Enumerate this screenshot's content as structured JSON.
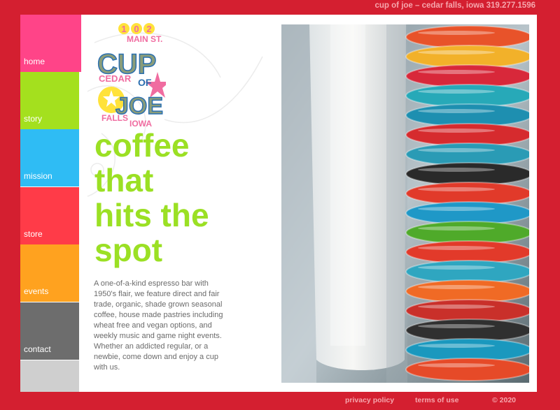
{
  "header": {
    "contact_line": "cup of joe – cedar falls, iowa 319.277.1596"
  },
  "nav": {
    "items": [
      {
        "label": "home",
        "color": "#ff4488"
      },
      {
        "label": "story",
        "color": "#a4e01e"
      },
      {
        "label": "mission",
        "color": "#2fbcf4"
      },
      {
        "label": "store",
        "color": "#ff3b48"
      },
      {
        "label": "events",
        "color": "#ffa21f"
      },
      {
        "label": "contact",
        "color": "#6d6d6d"
      }
    ],
    "blank_color": "#cfcfcf"
  },
  "logo": {
    "number": "102",
    "street": "MAIN ST.",
    "cup": "CUP",
    "of": "OF",
    "joe": "JOE",
    "cedar": "CEDAR",
    "falls": "FALLS",
    "iowa": "IOWA"
  },
  "main": {
    "headline": [
      "coffee",
      "that",
      "hits the",
      "spot"
    ],
    "description": "A one-of-a-kind espresso bar with 1950's flair, we feature direct and fair trade, organic, shade grown seasonal coffee, house made pastries including wheat free and vegan options, and weekly music and game night events. Whether an addicted regular, or a newbie, come down and enjoy a cup with us."
  },
  "footer": {
    "privacy": "privacy policy",
    "terms": "terms of use",
    "copyright": "© 2020"
  },
  "colors": {
    "brand_red": "#d41f30",
    "headline_green": "#9be024",
    "footer_pink": "#f6a6ad"
  }
}
